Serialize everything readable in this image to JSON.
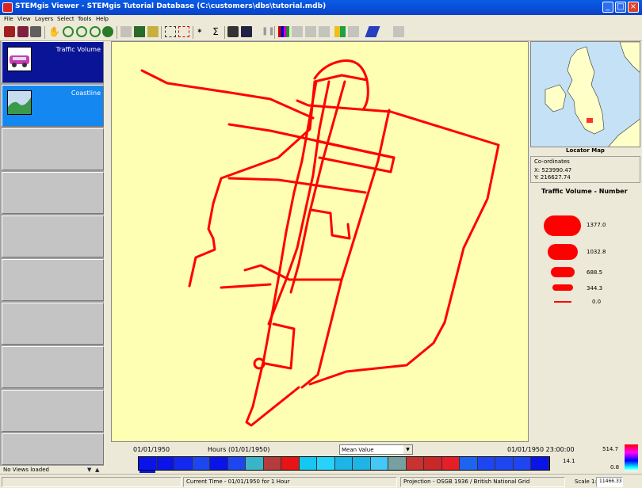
{
  "window": {
    "title": "STEMgis Viewer - STEMgis Tutorial Database (C:\\customers\\dbs\\tutorial.mdb)"
  },
  "menu": [
    "File",
    "View",
    "Layers",
    "Select",
    "Tools",
    "Help"
  ],
  "layers": [
    {
      "name": "Traffic Volume",
      "state": "selected-primary"
    },
    {
      "name": "Coastline",
      "state": "selected-secondary"
    }
  ],
  "layer_panel": {
    "status": "No Views loaded"
  },
  "locator": {
    "title": "Locator Map",
    "coords_label": "Co-ordinates",
    "x": "X: 523990.47",
    "y": "Y: 216627.74"
  },
  "legend": {
    "title": "Traffic Volume - Number",
    "values": [
      "1377.0",
      "1032.8",
      "688.5",
      "344.3",
      "0.0"
    ]
  },
  "timeline": {
    "start": "01/01/1950",
    "unit": "Hours (01/01/1950)",
    "aggregation": "Mean Value",
    "end": "01/01/1950 23:00:00",
    "scale_max": "514.7",
    "scale_mid": "14.1",
    "scale_min": "0.8",
    "colors": [
      "#0A14E6",
      "#0A14E6",
      "#1428F0",
      "#1E46F0",
      "#0A14E6",
      "#1E46F0",
      "#3CB4C8",
      "#B43C3C",
      "#E61414",
      "#14C8F0",
      "#28D2FA",
      "#1EB4E6",
      "#1EB4E6",
      "#46C8F5",
      "#78A0A0",
      "#C83232",
      "#C82828",
      "#E61E28",
      "#1E64F0",
      "#1E46F0",
      "#1E46F0",
      "#1E46F0",
      "#0A14E6"
    ]
  },
  "status": {
    "current_time": "Current Time - 01/01/1950 for 1 Hour",
    "projection": "Projection - OSGB 1936 / British National Grid",
    "scale_label": "Scale 1:",
    "scale_value": "11466.33"
  },
  "colors": {
    "road": "#FF0000",
    "map_bg": "#FFFFB4",
    "titlebar": "#0A5CE6"
  }
}
